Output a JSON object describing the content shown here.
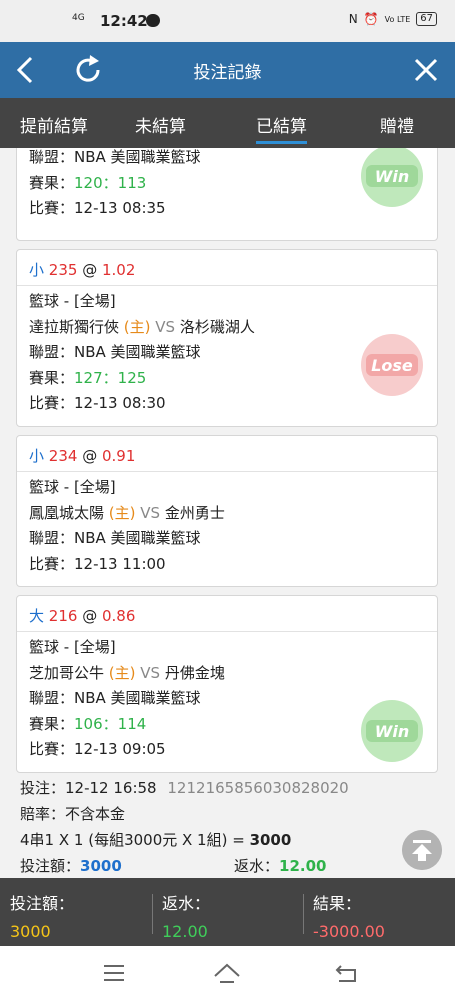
{
  "status_bar": {
    "network": "4G",
    "time": "12:42",
    "right_icons": [
      "N",
      "alarm",
      "Vo LTE"
    ],
    "battery": "67"
  },
  "nav": {
    "title": "投注記錄",
    "back_icon": "chevron-left-icon",
    "refresh_icon": "refresh-icon",
    "close_icon": "close-icon"
  },
  "tabs": [
    {
      "label": "提前結算",
      "active": false
    },
    {
      "label": "未結算",
      "active": false
    },
    {
      "label": "已結算",
      "active": true
    },
    {
      "label": "贈禮",
      "active": false
    }
  ],
  "bets": [
    {
      "partial": true,
      "league": "聯盟：NBA 美國職業籃球",
      "result_label": "賽果：",
      "result": "120：113",
      "time": "比賽：12-13 08:35",
      "outcome": "Win"
    },
    {
      "pick": "小",
      "line": "235",
      "at": "@",
      "odds": "1.02",
      "sport": "籃球 - [全場]",
      "home": "達拉斯獨行俠",
      "home_tag": "(主)",
      "vs": "VS",
      "away": "洛杉磯湖人",
      "league": "聯盟：NBA 美國職業籃球",
      "result_label": "賽果：",
      "result": "127：125",
      "time": "比賽：12-13 08:30",
      "outcome": "Lose"
    },
    {
      "pick": "小",
      "line": "234",
      "at": "@",
      "odds": "0.91",
      "sport": "籃球 - [全場]",
      "home": "鳳凰城太陽",
      "home_tag": "(主)",
      "vs": "VS",
      "away": "金州勇士",
      "league": "聯盟：NBA 美國職業籃球",
      "time": "比賽：12-13 11:00",
      "outcome": ""
    },
    {
      "pick": "大",
      "line": "216",
      "at": "@",
      "odds": "0.86",
      "sport": "籃球 - [全場]",
      "home": "芝加哥公牛",
      "home_tag": "(主)",
      "vs": "VS",
      "away": "丹佛金塊",
      "league": "聯盟：NBA 美國職業籃球",
      "result_label": "賽果：",
      "result": "106：114",
      "time": "比賽：12-13 09:05",
      "outcome": "Win"
    }
  ],
  "summary": {
    "bet_label": "投注：",
    "bet_time": "12-12 16:58",
    "bet_id": "1212165856030828020",
    "odds_note": "賠率：不含本金",
    "combo": "4串1 X 1 (每組3000元 X 1組) = ",
    "combo_total": "3000",
    "stake_label": "投注額：",
    "stake": "3000",
    "return_label": "返水：",
    "return": "12.00"
  },
  "footer": {
    "stake_label": "投注額：",
    "stake": "3000",
    "return_label": "返水：",
    "return": "12.00",
    "result_label": "結果：",
    "result": "-3000.00"
  },
  "colors": {
    "nav": "#2f6ea5",
    "tabs": "#444444",
    "win": "#9fd89a",
    "lose": "#f2a7a7",
    "green": "#2fb24a",
    "red": "#e03030",
    "orange": "#e68a1a",
    "yellow": "#f5c518"
  }
}
